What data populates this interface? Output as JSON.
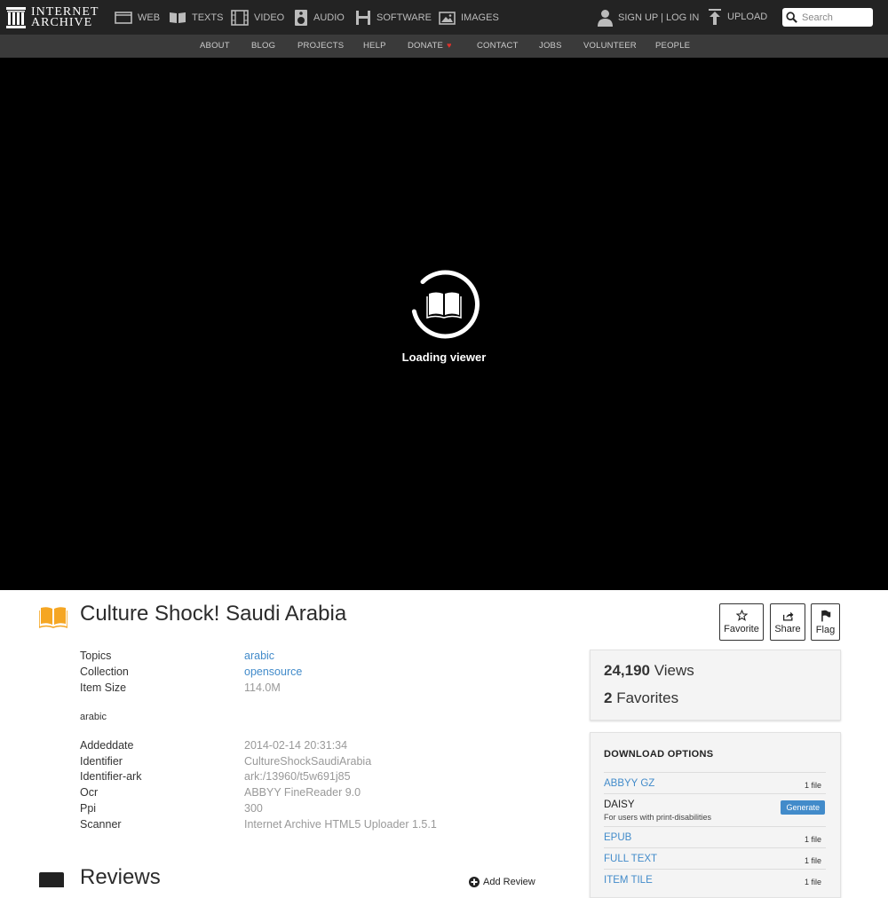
{
  "topnav": {
    "logo_line1": "INTERNET",
    "logo_line2": "ARCHIVE",
    "media": [
      {
        "label": "WEB",
        "icon": "web-icon"
      },
      {
        "label": "TEXTS",
        "icon": "texts-icon"
      },
      {
        "label": "VIDEO",
        "icon": "video-icon"
      },
      {
        "label": "AUDIO",
        "icon": "audio-icon"
      },
      {
        "label": "SOFTWARE",
        "icon": "software-icon"
      },
      {
        "label": "IMAGES",
        "icon": "images-icon"
      }
    ],
    "account": "SIGN UP | LOG IN",
    "upload": "UPLOAD",
    "search_placeholder": "Search"
  },
  "subnav": [
    "ABOUT",
    "BLOG",
    "PROJECTS",
    "HELP",
    "DONATE",
    "CONTACT",
    "JOBS",
    "VOLUNTEER",
    "PEOPLE"
  ],
  "viewer": {
    "loading": "Loading viewer"
  },
  "item": {
    "title": "Culture Shock! Saudi Arabia",
    "actions": [
      {
        "label": "Favorite",
        "icon": "star-icon"
      },
      {
        "label": "Share",
        "icon": "share-icon"
      },
      {
        "label": "Flag",
        "icon": "flag-icon"
      }
    ]
  },
  "metadata": {
    "top": [
      {
        "key": "Topics",
        "value": "arabic"
      },
      {
        "key": "Collection",
        "value": "opensource"
      },
      {
        "key": "Item Size",
        "value": "114.0M"
      }
    ],
    "description": "arabic",
    "bottom": [
      {
        "key": "Addeddate",
        "value": "2014-02-14 20:31:34"
      },
      {
        "key": "Identifier",
        "value": "CultureShockSaudiArabia"
      },
      {
        "key": "Identifier-ark",
        "value": "ark:/13960/t5w691j85"
      },
      {
        "key": "Ocr",
        "value": "ABBYY FineReader 9.0"
      },
      {
        "key": "Ppi",
        "value": "300"
      },
      {
        "key": "Scanner",
        "value": "Internet Archive HTML5 Uploader 1.5.1"
      }
    ]
  },
  "stats": {
    "views_count": "24,190",
    "views_label": "Views",
    "favorites_count": "2",
    "favorites_label": "Favorites"
  },
  "downloads": {
    "title": "DOWNLOAD OPTIONS",
    "rows": [
      {
        "name": "ABBYY GZ",
        "count": "1 file"
      },
      {
        "name": "DAISY",
        "sub": "For users with print-disabilities",
        "button": "Generate"
      },
      {
        "name": "EPUB",
        "count": "1 file"
      },
      {
        "name": "FULL TEXT",
        "count": "1 file"
      },
      {
        "name": "ITEM TILE",
        "count": "1 file"
      }
    ]
  },
  "reviews": {
    "title": "Reviews",
    "add": "Add Review"
  },
  "colors": {
    "topnav_bg": "#232323",
    "subnav_bg": "#3a3a3a",
    "link": "#428bca",
    "book_icon": "#f5a623",
    "donate_heart": "#e0312b"
  }
}
